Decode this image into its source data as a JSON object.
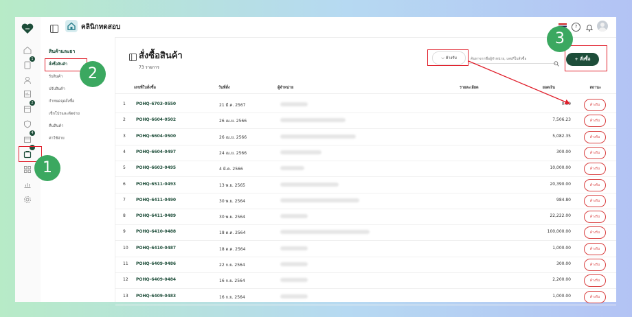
{
  "topbar": {
    "clinic_name": "คลินิกทดสอบ"
  },
  "submenu": {
    "heading": "สินค้าและยา",
    "items": [
      {
        "label": "สั่งซื้อสินค้า",
        "active": true
      },
      {
        "label": "รับสินค้า",
        "active": false
      },
      {
        "label": "ปรับสินค้า",
        "active": false
      },
      {
        "label": "กำหนดจุดสั่งซื้อ",
        "active": false
      },
      {
        "label": "เช็กโปรและตัดจ่าย",
        "active": false
      },
      {
        "label": "คืนสินค้า",
        "active": false
      },
      {
        "label": "ค่าใช้จ่าย",
        "active": false
      }
    ]
  },
  "rail_badges": [
    "1",
    "2",
    "4"
  ],
  "page": {
    "title": "สั่งซื้อสินค้า",
    "count": "73 รายการ",
    "filter_label": "ค้างรับ",
    "search_placeholder": "ค้นหาจากชื่อผู้จำหน่าย, เลขที่ใบสั่งซื้อ",
    "add_label": "+ สั่งซื้อ"
  },
  "table": {
    "headers": {
      "po": "เลขที่ใบสั่งซื้อ",
      "date": "วันที่สั่ง",
      "vendor": "ผู้จำหน่าย",
      "detail": "รายละเอียด",
      "amount": "ยอดเงิน",
      "status": "สถานะ"
    },
    "rows": [
      {
        "num": "1",
        "po": "POHQ-6703-0550",
        "date": "21 มี.ค. 2567",
        "amount": "0.00",
        "status": "ค้างรับ"
      },
      {
        "num": "2",
        "po": "POHQ-6604-0502",
        "date": "26 เม.ย. 2566",
        "amount": "7,506.23",
        "status": "ค้างรับ"
      },
      {
        "num": "3",
        "po": "POHQ-6604-0500",
        "date": "26 เม.ย. 2566",
        "amount": "5,082.35",
        "status": "ค้างรับ"
      },
      {
        "num": "4",
        "po": "POHQ-6604-0497",
        "date": "24 เม.ย. 2566",
        "amount": "300.00",
        "status": "ค้างรับ"
      },
      {
        "num": "5",
        "po": "POHQ-6603-0495",
        "date": "4 มี.ค. 2566",
        "amount": "10,000.00",
        "status": "ค้างรับ"
      },
      {
        "num": "6",
        "po": "POHQ-6511-0493",
        "date": "13 พ.ย. 2565",
        "amount": "20,390.00",
        "status": "ค้างรับ"
      },
      {
        "num": "7",
        "po": "POHQ-6411-0490",
        "date": "30 พ.ย. 2564",
        "amount": "984.80",
        "status": "ค้างรับ"
      },
      {
        "num": "8",
        "po": "POHQ-6411-0489",
        "date": "30 พ.ย. 2564",
        "amount": "22,222.00",
        "status": "ค้างรับ"
      },
      {
        "num": "9",
        "po": "POHQ-6410-0488",
        "date": "18 ต.ค. 2564",
        "amount": "100,000.00",
        "status": "ค้างรับ"
      },
      {
        "num": "10",
        "po": "POHQ-6410-0487",
        "date": "18 ต.ค. 2564",
        "amount": "1,000.00",
        "status": "ค้างรับ"
      },
      {
        "num": "11",
        "po": "POHQ-6409-0486",
        "date": "22 ก.ย. 2564",
        "amount": "300.00",
        "status": "ค้างรับ"
      },
      {
        "num": "12",
        "po": "POHQ-6409-0484",
        "date": "16 ก.ย. 2564",
        "amount": "2,200.00",
        "status": "ค้างรับ"
      },
      {
        "num": "13",
        "po": "POHQ-6409-0483",
        "date": "16 ก.ย. 2564",
        "amount": "1,000.00",
        "status": "ค้างรับ"
      }
    ]
  },
  "annotations": {
    "steps": [
      "1",
      "2",
      "3"
    ],
    "highlight_color": "#e01e2a",
    "step_color": "#3ba860"
  },
  "brand_color": "#1d4d39"
}
